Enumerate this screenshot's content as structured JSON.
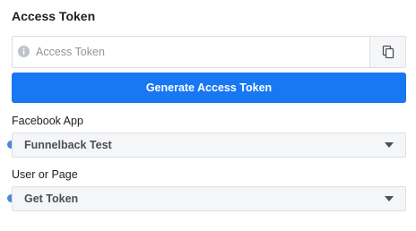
{
  "access_token": {
    "title": "Access Token",
    "field_value": "",
    "field_placeholder": "Access Token",
    "generate_label": "Generate Access Token"
  },
  "facebook_app": {
    "label": "Facebook App",
    "selected": "Funnelback Test"
  },
  "user_or_page": {
    "label": "User or Page",
    "selected": "Get Token"
  },
  "colors": {
    "primary_button": "#1877f2",
    "indicator_dot": "#4a89dc",
    "select_bg": "#f5f6f7",
    "border": "#dddfe2"
  },
  "icons": {
    "field_info": "info-icon",
    "copy": "copy-icon",
    "dropdown": "caret-down-icon"
  }
}
